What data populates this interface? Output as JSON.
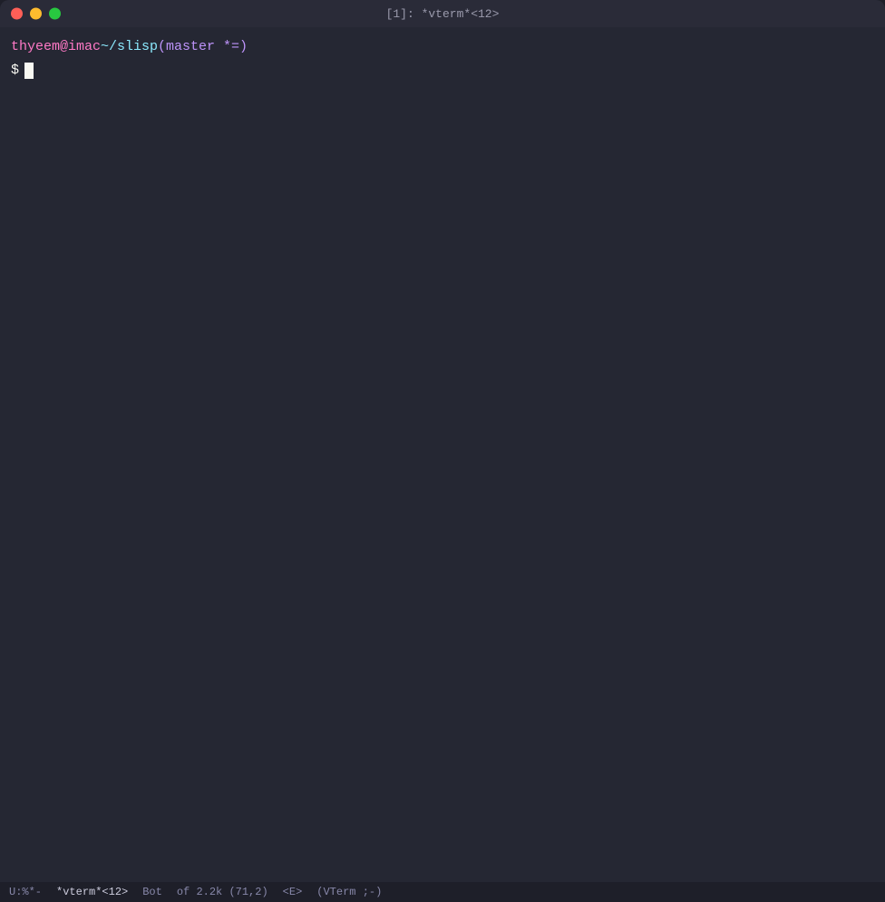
{
  "titlebar": {
    "title": "[1]: *vterm*<12>",
    "traffic_lights": {
      "close_label": "close",
      "minimize_label": "minimize",
      "maximize_label": "maximize"
    }
  },
  "terminal": {
    "prompt": {
      "user_host": "thyeem@imac",
      "path": " ~/slisp",
      "git_branch": " (master *=)"
    },
    "dollar_sign": "$"
  },
  "status_bar": {
    "mode": "U:%*-",
    "buffer": "*vterm*<12>",
    "position_label": "Bot",
    "position_detail": "of 2.2k (71,2)",
    "mode_indicator": "<E>",
    "major_mode": "(VTerm ;-)"
  }
}
